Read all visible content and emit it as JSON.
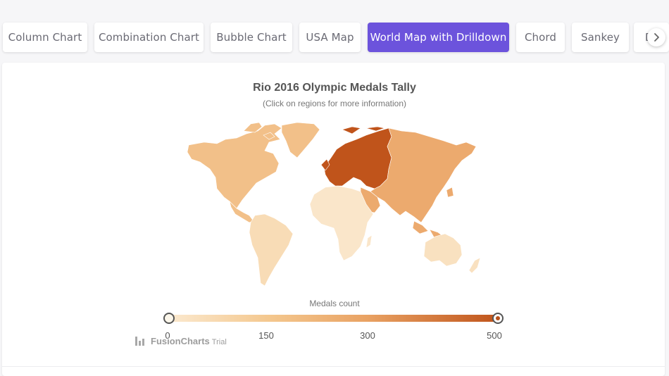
{
  "tabs": [
    {
      "label": "Column Chart",
      "active": false
    },
    {
      "label": "Combination Chart",
      "active": false
    },
    {
      "label": "Bubble Chart",
      "active": false
    },
    {
      "label": "USA Map",
      "active": false
    },
    {
      "label": "World Map with Drilldown",
      "active": true
    },
    {
      "label": "Chord",
      "active": false
    },
    {
      "label": "Sankey",
      "active": false
    },
    {
      "label": "D",
      "active": false
    }
  ],
  "scroll": {
    "icon": "chevron-right-icon"
  },
  "chart": {
    "title": "Rio 2016 Olympic Medals Tally",
    "subtitle": "(Click on regions for more information)"
  },
  "legend": {
    "caption": "Medals count",
    "min_label": "0",
    "mid1_label": "150",
    "mid2_label": "300",
    "max_label": "500",
    "range_min": 0,
    "range_max": 500,
    "colors": [
      "#fbe9cf",
      "#f4c88f",
      "#e9a263",
      "#c0541b"
    ]
  },
  "watermark": {
    "brand": "FusionCharts",
    "suffix": "Trial"
  },
  "colors": {
    "accent": "#6c53dc",
    "europe": "#c0541b",
    "asia": "#ecaa6e",
    "north_america": "#f2c089",
    "south_america": "#f8dcb6",
    "africa": "#fae6ca",
    "australia": "#f9e1c0",
    "greenland": "#f2c089"
  }
}
